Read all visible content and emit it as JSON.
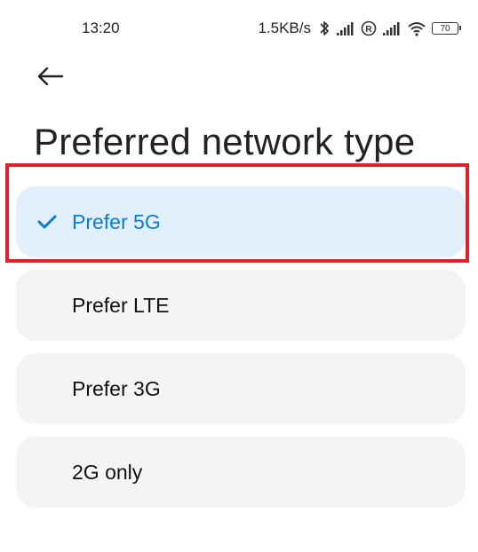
{
  "status_bar": {
    "time": "13:20",
    "net_speed": "1.5KB/s",
    "battery_level": "70",
    "icons": [
      "bluetooth-icon",
      "signal-icon",
      "roaming-icon",
      "signal-icon",
      "wifi-icon",
      "battery-icon"
    ]
  },
  "header": {
    "back_icon": "back-arrow-icon",
    "title": "Preferred network type"
  },
  "options": [
    {
      "label": "Prefer 5G",
      "selected": true
    },
    {
      "label": "Prefer LTE",
      "selected": false
    },
    {
      "label": "Prefer 3G",
      "selected": false
    },
    {
      "label": "2G only",
      "selected": false
    }
  ],
  "colors": {
    "accent": "#0c7bd6",
    "selected_bg": "#e2f0fd",
    "option_bg": "#f4f4f4",
    "highlight": "#e0202a"
  }
}
